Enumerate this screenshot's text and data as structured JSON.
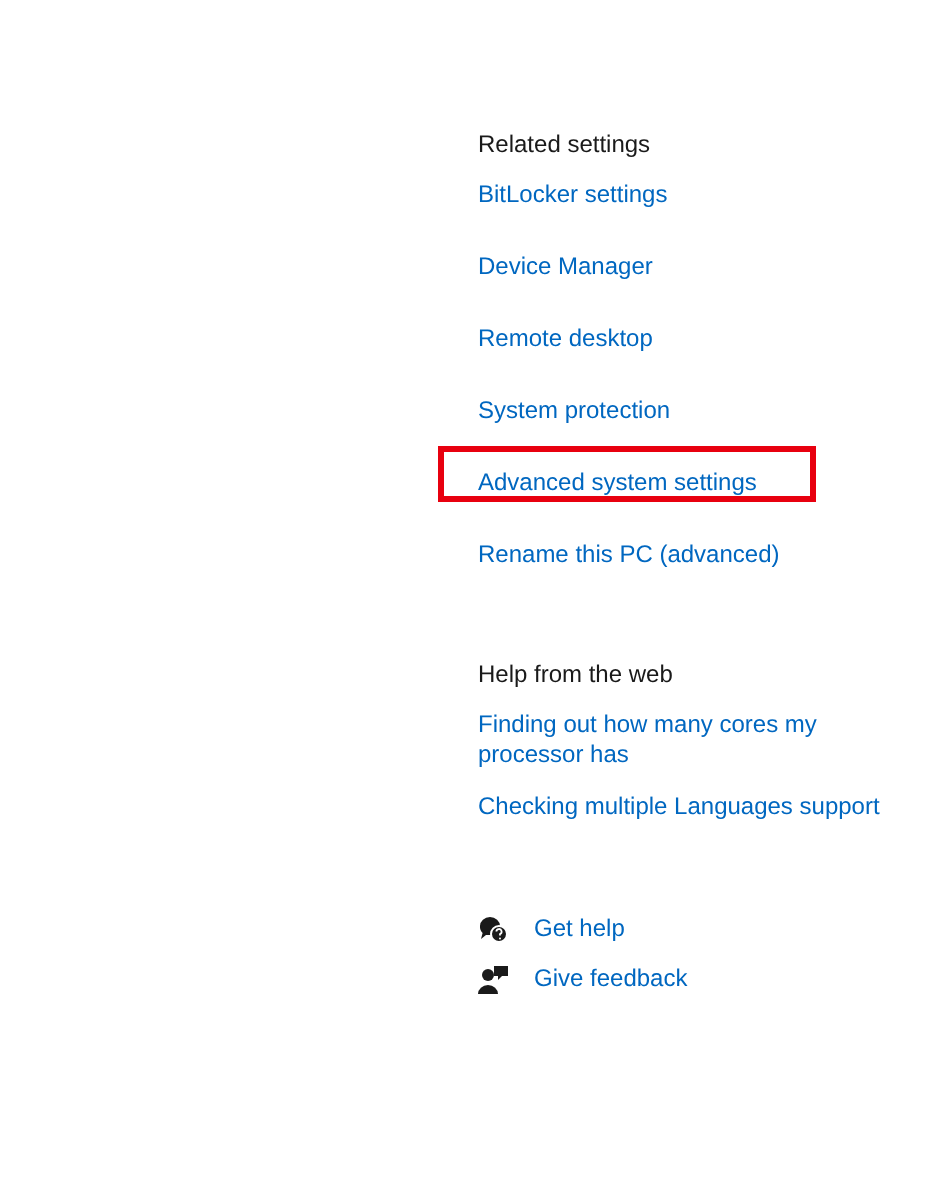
{
  "related_settings": {
    "heading": "Related settings",
    "links": [
      {
        "label": "BitLocker settings",
        "highlighted": false
      },
      {
        "label": "Device Manager",
        "highlighted": false
      },
      {
        "label": "Remote desktop",
        "highlighted": false
      },
      {
        "label": "System protection",
        "highlighted": false
      },
      {
        "label": "Advanced system settings",
        "highlighted": true
      },
      {
        "label": "Rename this PC (advanced)",
        "highlighted": false
      }
    ]
  },
  "help_from_the_web": {
    "heading": "Help from the web",
    "links": [
      {
        "label": "Finding out how many cores my processor has"
      },
      {
        "label": "Checking multiple Languages support"
      }
    ]
  },
  "support_links": [
    {
      "kind": "help",
      "label": "Get help"
    },
    {
      "kind": "feedback",
      "label": "Give feedback"
    }
  ]
}
